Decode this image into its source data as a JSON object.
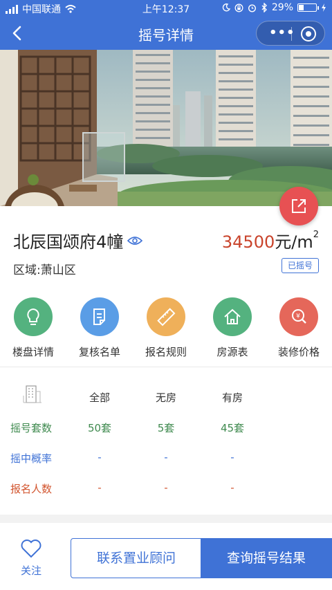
{
  "status_bar": {
    "carrier": "中国联通",
    "time": "上午12:37",
    "battery": "29%",
    "battery_level": 0.29
  },
  "nav": {
    "title": "摇号详情"
  },
  "project": {
    "name": "北辰国颂府4幢",
    "price_value": "34500",
    "price_unit": "元/m",
    "price_sup": "2",
    "district": "区域:萧山区",
    "status": "已摇号"
  },
  "menu": [
    {
      "label": "楼盘详情",
      "icon": "lightbulb-icon",
      "color": "#54b27f"
    },
    {
      "label": "复核名单",
      "icon": "document-icon",
      "color": "#5a9de6"
    },
    {
      "label": "报名规则",
      "icon": "ruler-icon",
      "color": "#efb05a"
    },
    {
      "label": "房源表",
      "icon": "house-icon",
      "color": "#54b27f"
    },
    {
      "label": "装修价格",
      "icon": "price-search-icon",
      "color": "#e5675a"
    }
  ],
  "table": {
    "headers": [
      "全部",
      "无房",
      "有房"
    ],
    "rows": [
      {
        "label": "摇号套数",
        "values": [
          "50套",
          "5套",
          "45套"
        ],
        "color": "#3f8a4f"
      },
      {
        "label": "摇中概率",
        "values": [
          "-",
          "-",
          "-"
        ],
        "color": "#3f72d6"
      },
      {
        "label": "报名人数",
        "values": [
          "-",
          "-",
          "-"
        ],
        "color": "#d2552f"
      }
    ]
  },
  "bottom": {
    "follow_label": "关注",
    "contact_label": "联系置业顾问",
    "query_label": "查询摇号结果"
  },
  "colors": {
    "primary": "#3f72d6",
    "price": "#c9442c",
    "share": "#e75153"
  }
}
